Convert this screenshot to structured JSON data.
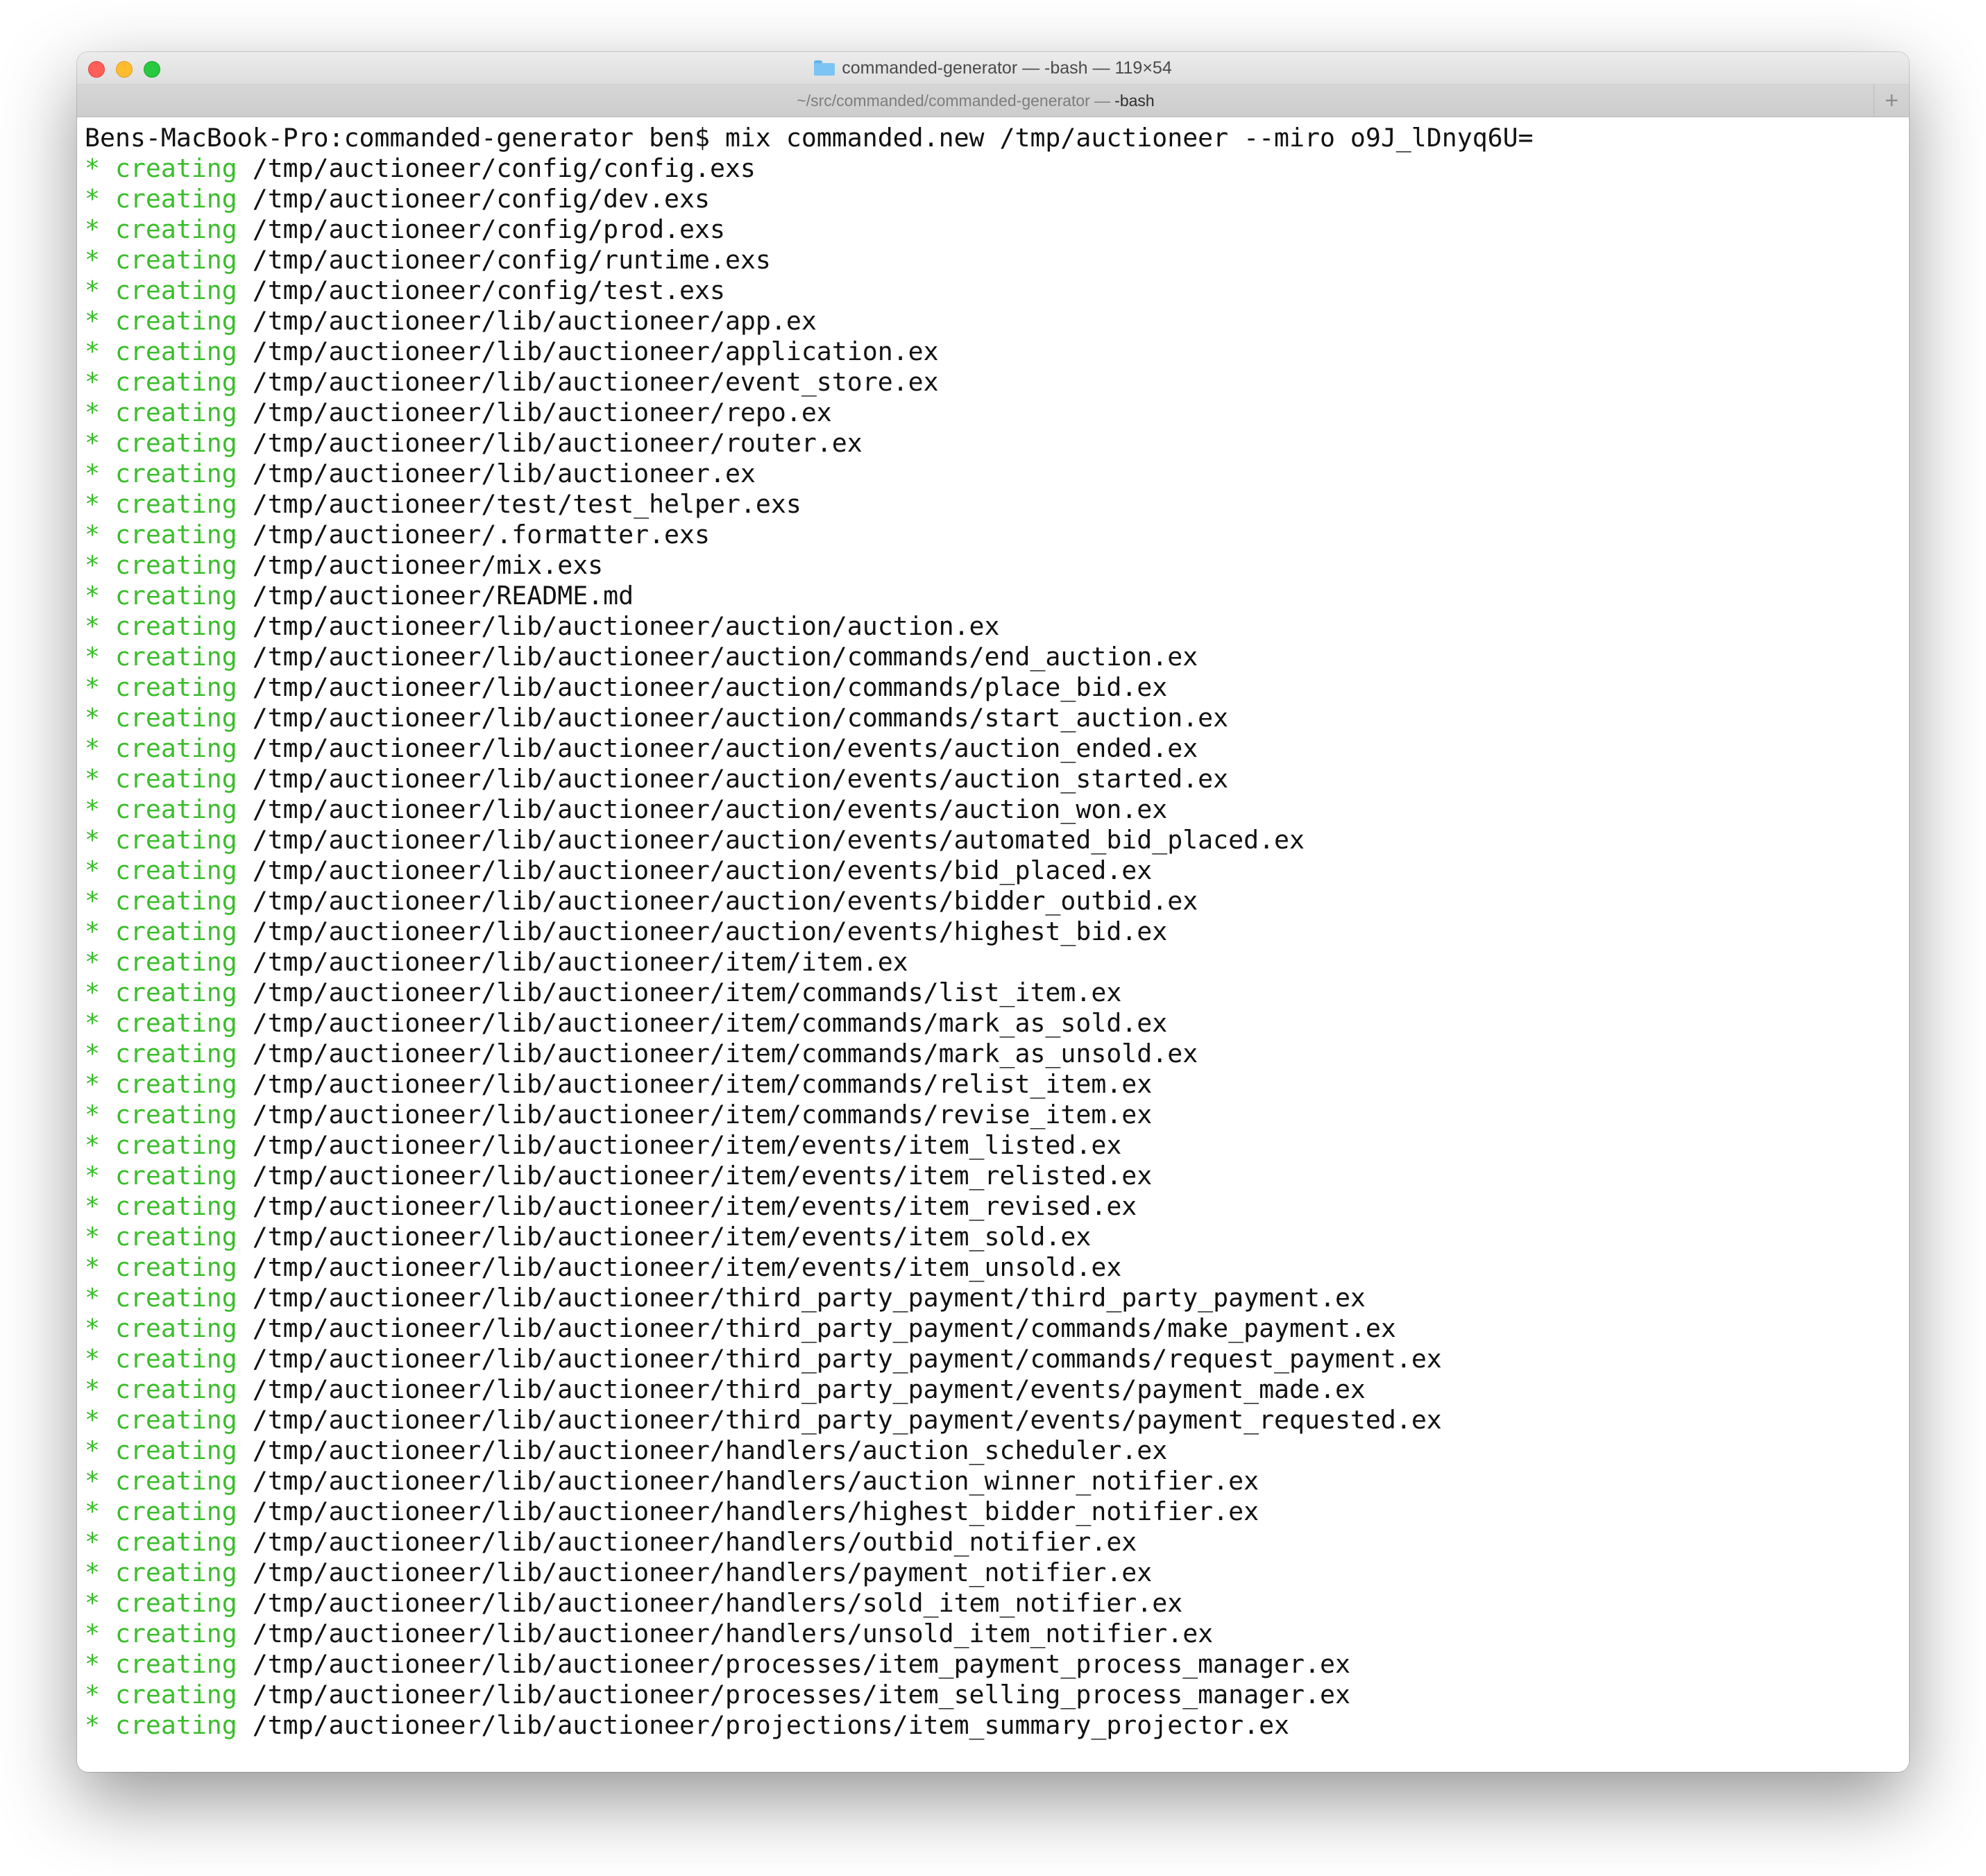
{
  "window": {
    "title": "commanded-generator — -bash — 119×54",
    "title_icon": "folder-icon",
    "tab": {
      "path": "~/src/commanded/commanded-generator —",
      "process": "-bash"
    },
    "new_tab_label": "+"
  },
  "colors": {
    "status_green": "#3bbd2c",
    "text": "#111111",
    "background": "#ffffff"
  },
  "terminal": {
    "command_line": "Bens-MacBook-Pro:commanded-generator ben$ mix commanded.new /tmp/auctioneer --miro o9J_lDnyq6U=",
    "status_prefix": "* creating",
    "files": [
      "/tmp/auctioneer/config/config.exs",
      "/tmp/auctioneer/config/dev.exs",
      "/tmp/auctioneer/config/prod.exs",
      "/tmp/auctioneer/config/runtime.exs",
      "/tmp/auctioneer/config/test.exs",
      "/tmp/auctioneer/lib/auctioneer/app.ex",
      "/tmp/auctioneer/lib/auctioneer/application.ex",
      "/tmp/auctioneer/lib/auctioneer/event_store.ex",
      "/tmp/auctioneer/lib/auctioneer/repo.ex",
      "/tmp/auctioneer/lib/auctioneer/router.ex",
      "/tmp/auctioneer/lib/auctioneer.ex",
      "/tmp/auctioneer/test/test_helper.exs",
      "/tmp/auctioneer/.formatter.exs",
      "/tmp/auctioneer/mix.exs",
      "/tmp/auctioneer/README.md",
      "/tmp/auctioneer/lib/auctioneer/auction/auction.ex",
      "/tmp/auctioneer/lib/auctioneer/auction/commands/end_auction.ex",
      "/tmp/auctioneer/lib/auctioneer/auction/commands/place_bid.ex",
      "/tmp/auctioneer/lib/auctioneer/auction/commands/start_auction.ex",
      "/tmp/auctioneer/lib/auctioneer/auction/events/auction_ended.ex",
      "/tmp/auctioneer/lib/auctioneer/auction/events/auction_started.ex",
      "/tmp/auctioneer/lib/auctioneer/auction/events/auction_won.ex",
      "/tmp/auctioneer/lib/auctioneer/auction/events/automated_bid_placed.ex",
      "/tmp/auctioneer/lib/auctioneer/auction/events/bid_placed.ex",
      "/tmp/auctioneer/lib/auctioneer/auction/events/bidder_outbid.ex",
      "/tmp/auctioneer/lib/auctioneer/auction/events/highest_bid.ex",
      "/tmp/auctioneer/lib/auctioneer/item/item.ex",
      "/tmp/auctioneer/lib/auctioneer/item/commands/list_item.ex",
      "/tmp/auctioneer/lib/auctioneer/item/commands/mark_as_sold.ex",
      "/tmp/auctioneer/lib/auctioneer/item/commands/mark_as_unsold.ex",
      "/tmp/auctioneer/lib/auctioneer/item/commands/relist_item.ex",
      "/tmp/auctioneer/lib/auctioneer/item/commands/revise_item.ex",
      "/tmp/auctioneer/lib/auctioneer/item/events/item_listed.ex",
      "/tmp/auctioneer/lib/auctioneer/item/events/item_relisted.ex",
      "/tmp/auctioneer/lib/auctioneer/item/events/item_revised.ex",
      "/tmp/auctioneer/lib/auctioneer/item/events/item_sold.ex",
      "/tmp/auctioneer/lib/auctioneer/item/events/item_unsold.ex",
      "/tmp/auctioneer/lib/auctioneer/third_party_payment/third_party_payment.ex",
      "/tmp/auctioneer/lib/auctioneer/third_party_payment/commands/make_payment.ex",
      "/tmp/auctioneer/lib/auctioneer/third_party_payment/commands/request_payment.ex",
      "/tmp/auctioneer/lib/auctioneer/third_party_payment/events/payment_made.ex",
      "/tmp/auctioneer/lib/auctioneer/third_party_payment/events/payment_requested.ex",
      "/tmp/auctioneer/lib/auctioneer/handlers/auction_scheduler.ex",
      "/tmp/auctioneer/lib/auctioneer/handlers/auction_winner_notifier.ex",
      "/tmp/auctioneer/lib/auctioneer/handlers/highest_bidder_notifier.ex",
      "/tmp/auctioneer/lib/auctioneer/handlers/outbid_notifier.ex",
      "/tmp/auctioneer/lib/auctioneer/handlers/payment_notifier.ex",
      "/tmp/auctioneer/lib/auctioneer/handlers/sold_item_notifier.ex",
      "/tmp/auctioneer/lib/auctioneer/handlers/unsold_item_notifier.ex",
      "/tmp/auctioneer/lib/auctioneer/processes/item_payment_process_manager.ex",
      "/tmp/auctioneer/lib/auctioneer/processes/item_selling_process_manager.ex",
      "/tmp/auctioneer/lib/auctioneer/projections/item_summary_projector.ex"
    ]
  }
}
